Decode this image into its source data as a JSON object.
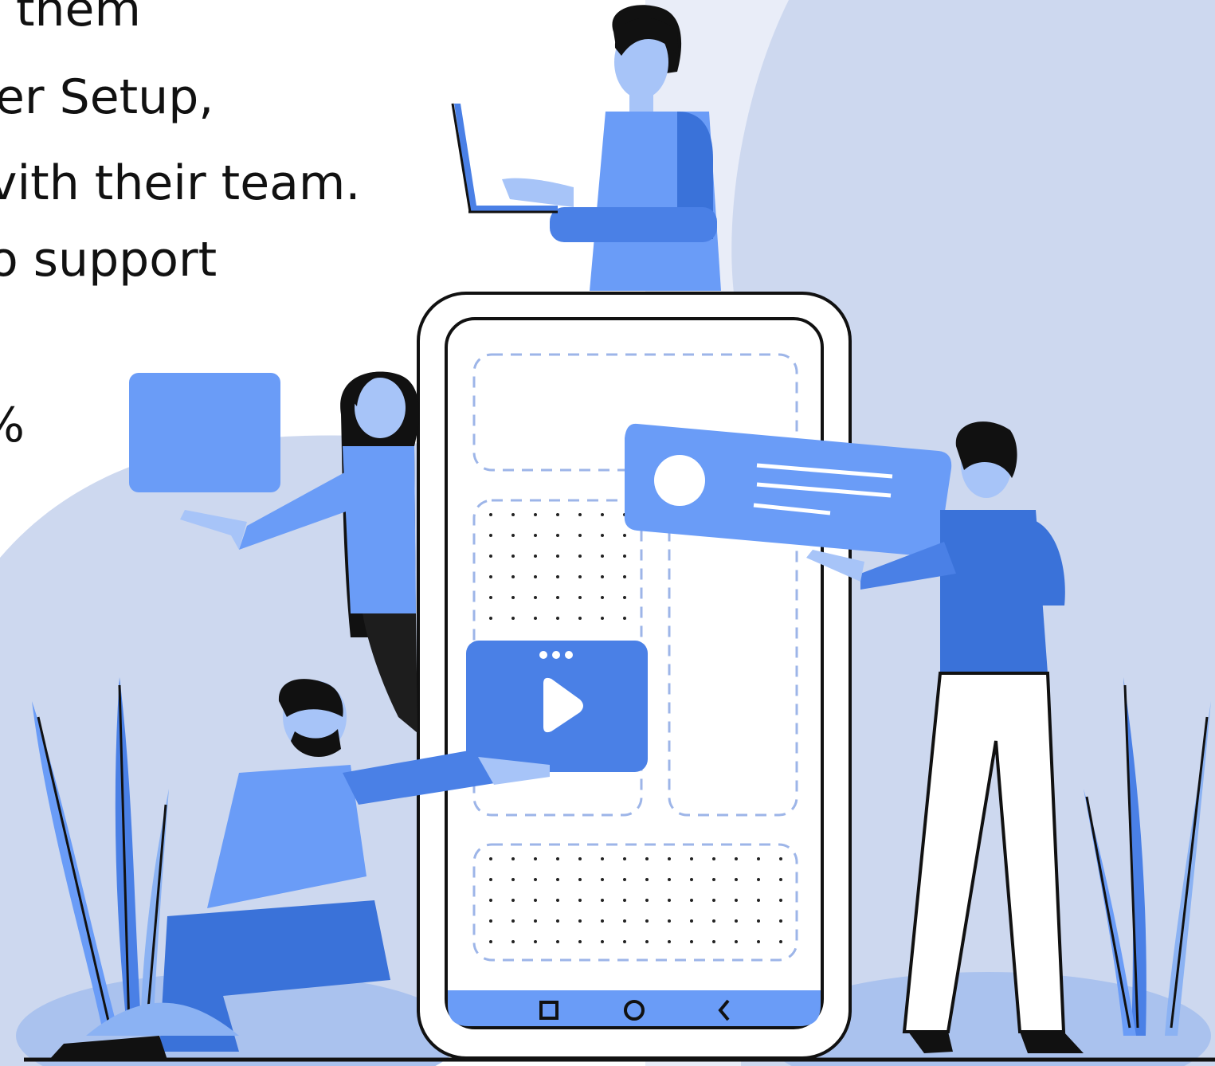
{
  "text_lines": [
    "them",
    "er Setup,",
    "vith their team.",
    "o support",
    "%"
  ],
  "phone_nav": {
    "icons": [
      "square-nav-icon",
      "circle-nav-icon",
      "back-chevron-icon"
    ]
  },
  "video_card": {
    "icons": [
      "more-dots-icon",
      "play-icon"
    ]
  },
  "colors": {
    "bg_light": "#e9edf8",
    "bg_blob": "#cdd8ef",
    "brand_blue": "#6a9cf7",
    "mid_blue": "#4a80e6",
    "dark_blue": "#3a72d9",
    "leaf_light": "#8bb2f3",
    "outline": "#111111",
    "skin": "#a7c4f8"
  }
}
